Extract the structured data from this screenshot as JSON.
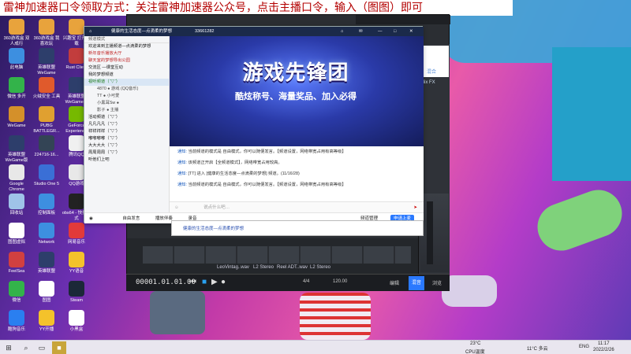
{
  "banner": "雷神加速器口令领取方式：关注雷神加速器公众号，点击主播口令，输入（图图）即可",
  "desktop_icons": [
    {
      "label": "360游戏盒 双人成行",
      "color": "#e8a33c"
    },
    {
      "label": "360游戏盒 我喜欢玩",
      "color": "#e8a33c"
    },
    {
      "label": "兴趣宝 打开下载",
      "color": "#e8a33c"
    },
    {
      "label": "此电脑",
      "color": "#3d8fe0"
    },
    {
      "label": "英雄联盟 WeGame",
      "color": "#2d3e6b"
    },
    {
      "label": "Rust Client",
      "color": "#c23d3d"
    },
    {
      "label": "微信 多开",
      "color": "#33b34a"
    },
    {
      "label": "火绒安全 工具",
      "color": "#e05a2c"
    },
    {
      "label": "英雄联盟 WeGame版",
      "color": "#2d3e6b"
    },
    {
      "label": "WeGame",
      "color": "#d4902a"
    },
    {
      "label": "PUBG BATTLEGR...",
      "color": "#e0a030"
    },
    {
      "label": "GeForce Experience",
      "color": "#76b900"
    },
    {
      "label": "英雄联盟 WeGame版",
      "color": "#2d3e6b"
    },
    {
      "label": "224716-16...",
      "color": "#334455"
    },
    {
      "label": "腾讯QQ",
      "color": "#f0f0f0"
    },
    {
      "label": "Google Chrome",
      "color": "#e8e8e8"
    },
    {
      "label": "Studio One 5",
      "color": "#3a6fd6"
    },
    {
      "label": "QQ游戏",
      "color": "#e8e8e8"
    },
    {
      "label": "回收站",
      "color": "#9fc3e8"
    },
    {
      "label": "控制面板",
      "color": "#3d8fe0"
    },
    {
      "label": "obs64 - 快捷方式",
      "color": "#222222"
    },
    {
      "label": "图图虚拟",
      "color": "#ffffff"
    },
    {
      "label": "Network",
      "color": "#3d8fe0"
    },
    {
      "label": "网易音乐",
      "color": "#e23a3a"
    },
    {
      "label": "FeelSea",
      "color": "#d14040"
    },
    {
      "label": "英雄联盟",
      "color": "#2d3e6b"
    },
    {
      "label": "YY语音",
      "color": "#f4c22b"
    },
    {
      "label": "微信",
      "color": "#33b34a"
    },
    {
      "label": "图图",
      "color": "#ffffff"
    },
    {
      "label": "Steam",
      "color": "#1b2838"
    },
    {
      "label": "酷狗音乐",
      "color": "#2a7ff0"
    },
    {
      "label": "YY开播",
      "color": "#f4c22b"
    },
    {
      "label": "小黑盒",
      "color": "#ffffff"
    }
  ],
  "qq": {
    "title": "健康的生活态度—点滴柔的梦想",
    "group_id": "33661282",
    "sidebar_header": "频道模式",
    "sidebar": [
      {
        "text": "欢迎来到主播频道—点滴柔的梦想",
        "color": "#111111"
      },
      {
        "text": "新年音乐播放大厅",
        "color": "#c02020"
      },
      {
        "text": "聊天室的梦想导出公园",
        "color": "#c02020"
      },
      {
        "text": "交流区 —课堂互动",
        "color": "#111111"
      },
      {
        "text": "我的梦想频道",
        "color": "#111111"
      },
      {
        "text": "视听频道（ ̄▽ ̄）",
        "color": "#1a7a1a"
      },
      {
        "text": "4870 ● 游戏 (QQ音乐)",
        "color": "#444444"
      },
      {
        "text": "TT ● 小可爱",
        "color": "#444444"
      },
      {
        "text": "小黑耳Sw ●",
        "color": "#444444"
      },
      {
        "text": "影子 ● 主播",
        "color": "#444444"
      },
      {
        "text": "活动频道（ ̄▽ ̄）",
        "color": "#111111"
      },
      {
        "text": "凡凡凡凡（ ̄▽ ̄）",
        "color": "#111111"
      },
      {
        "text": "祥祥祥祥（ ̄▽ ̄）",
        "color": "#111111"
      },
      {
        "text": "嘟嘟嘟嘟（ ̄▽ ̄）",
        "color": "#111111"
      },
      {
        "text": "大大大大（ ̄▽ ̄）",
        "color": "#111111"
      },
      {
        "text": "周周周周（ ̄▽ ̄）",
        "color": "#111111"
      },
      {
        "text": "听他们上吧",
        "color": "#111111"
      }
    ],
    "banner_title": "游戏先锋团",
    "banner_sub": "酷炫称号、海量奖品、加入必得",
    "messages": [
      {
        "prefix": "通知:",
        "text": "当前频道的模式是 自由模式，你可以随便发言。【频道设置，网络带宽占用有高等级】"
      },
      {
        "prefix": "通知:",
        "text": "该频道正开启【全频道模式】，网络带宽占用较高。"
      },
      {
        "prefix": "通知:",
        "text": "[TT] 进入 [健康的生活态度—点滴柔的梦想] 频道。(11/16/28)"
      },
      {
        "prefix": "通知:",
        "text": "当前频道的模式是 自由模式，你可以随便发言。【频道设置，网络带宽占用有高等级】"
      }
    ],
    "input_placeholder": "说点什么吧…",
    "bottom": {
      "mic": "自由发言",
      "hold": "播放伴奏",
      "sound": "录音",
      "settings": "频道管理",
      "apply": "申请上麦"
    }
  },
  "sub_window": "健康的生活态度—点滴柔的梦想",
  "daw": {
    "time": "00001.01.01.00",
    "tracks": [
      "LeoVintag..wav",
      "L2 Stereo",
      "Reel ADT..wav",
      "L2 Stereo"
    ],
    "tempo": "120.00",
    "signature": "4/4",
    "right_tabs": [
      "编辑",
      "混音",
      "浏览"
    ],
    "right_top": "混合",
    "panel_label": "Mix FX"
  },
  "taskbar": {
    "temp": "11°C 多云",
    "cpu": "CPU温度",
    "cpu_val": "23°C",
    "lang": "ENG",
    "time": "11:17",
    "date": "2022/2/26"
  }
}
